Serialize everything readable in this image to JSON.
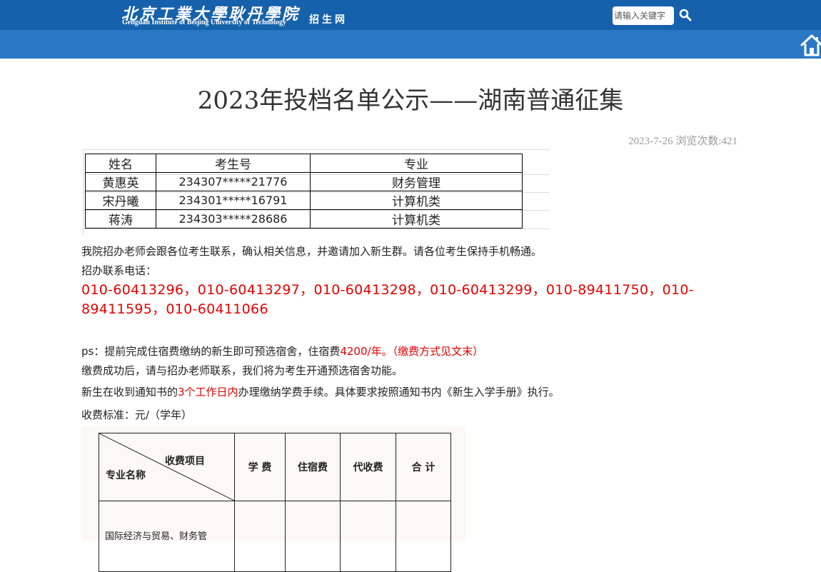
{
  "header": {
    "logo_cn": "北京工業大學耿丹學院",
    "logo_en": "Gengdan Institute of Beijing University of Technology",
    "logo_sub": "招生网",
    "search_placeholder": "请输入关键字",
    "colors": {
      "top": "#1661ab",
      "bar": "#2a78c5"
    }
  },
  "article": {
    "title": "2023年投档名单公示——湖南普通征集",
    "date": "2023-7-26",
    "views_label": "浏览次数:",
    "views": "421"
  },
  "admissions_table": {
    "headers": [
      "姓名",
      "考生号",
      "专业"
    ],
    "rows": [
      [
        "黄惠英",
        "234307*****21776",
        "财务管理"
      ],
      [
        "宋丹曦",
        "234301*****16791",
        "计算机类"
      ],
      [
        "蒋涛",
        "234303*****28686",
        "计算机类"
      ]
    ]
  },
  "body": {
    "line1": "我院招办老师会跟各位考生联系，确认相关信息，并邀请加入新生群。请各位考生保持手机畅通。",
    "contact_label": "招办联系电话：",
    "phones": "010-60413296，010-60413297，010-60413298，010-60413299，010-89411750，010-89411595，010-60411066",
    "ps_prefix": "ps：提前完成住宿费缴纳的新生即可预选宿舍，住宿费",
    "ps_fee": "4200/年。（缴费方式见文末）",
    "ps2": "缴费成功后，请与招办老师联系，我们将为考生开通预选宿舍功能。",
    "notice_a": "新生在收到通知书的",
    "notice_b": "3个工作日内",
    "notice_c": "办理缴纳学费手续。具体要求按照通知书内《新生入学手册》执行。",
    "fee_standard": "收费标准：元/（学年）"
  },
  "fee_table": {
    "corner_top": "收费项目",
    "corner_bottom": "专业名称",
    "headers": [
      "学 费",
      "住宿费",
      "代收费",
      "合 计"
    ],
    "first_row": "国际经济与贸易、财务管"
  }
}
